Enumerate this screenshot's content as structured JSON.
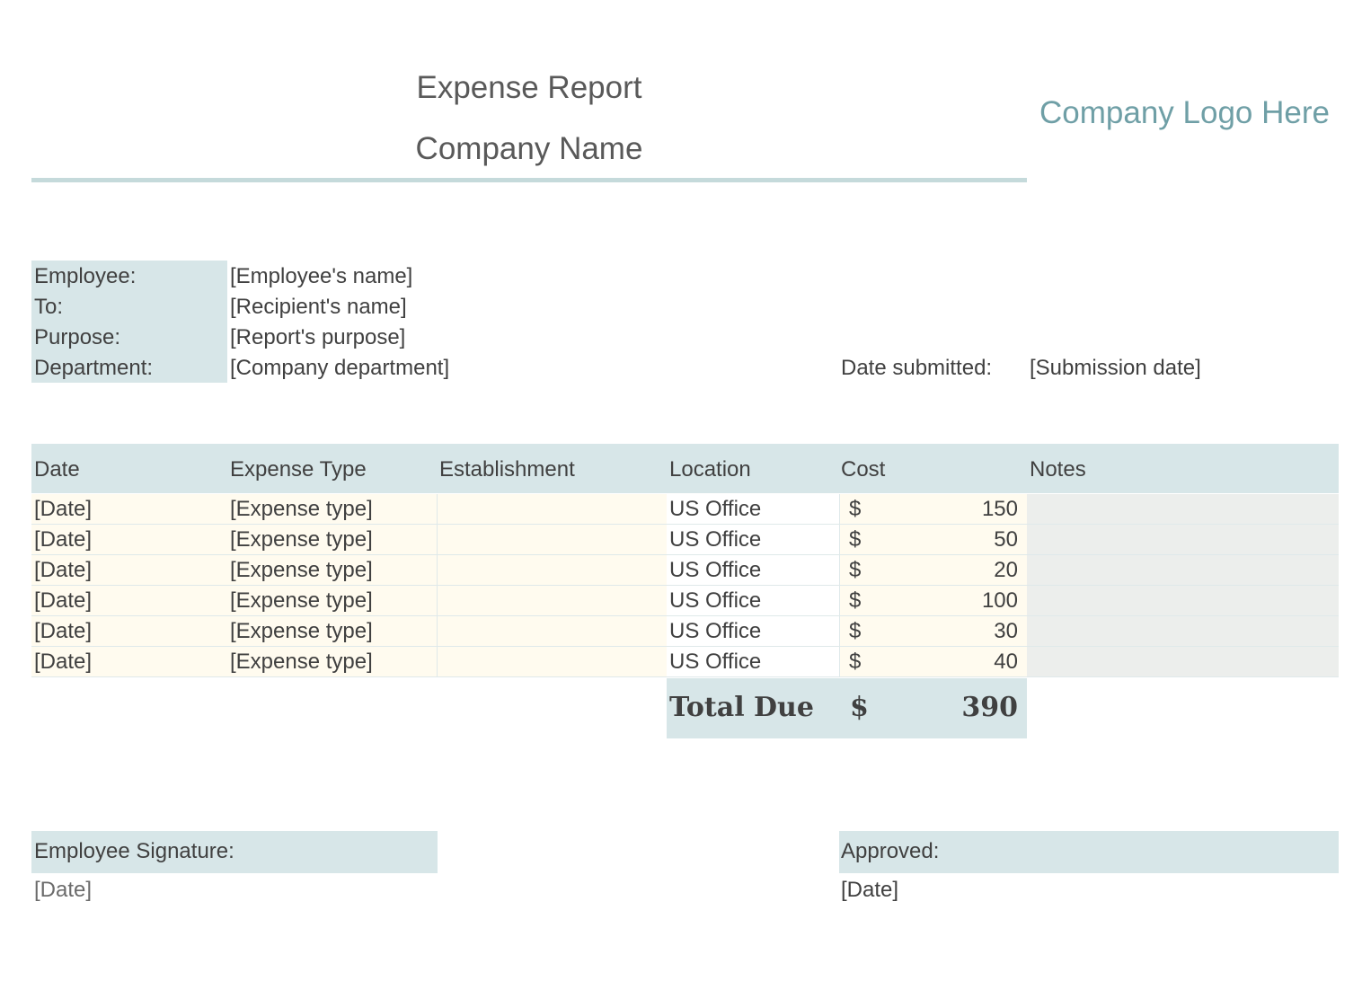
{
  "header": {
    "title": "Expense Report",
    "company_name": "Company Name",
    "logo_placeholder": "Company Logo Here"
  },
  "info": {
    "employee_label": "Employee:",
    "employee_value": "[Employee's name]",
    "to_label": "To:",
    "to_value": "[Recipient's name]",
    "purpose_label": "Purpose:",
    "purpose_value": "[Report's purpose]",
    "department_label": "Department:",
    "department_value": "[Company department]",
    "date_submitted_label": "Date submitted:",
    "date_submitted_value": "[Submission date]"
  },
  "table": {
    "columns": [
      "Date",
      "Expense Type",
      "Establishment",
      "Location",
      "Cost",
      "Notes"
    ],
    "rows": [
      {
        "date": "[Date]",
        "type": "[Expense type]",
        "establishment": "",
        "location": "US Office",
        "currency": "$",
        "cost": "150",
        "notes": ""
      },
      {
        "date": "[Date]",
        "type": "[Expense type]",
        "establishment": "",
        "location": "US Office",
        "currency": "$",
        "cost": "50",
        "notes": ""
      },
      {
        "date": "[Date]",
        "type": "[Expense type]",
        "establishment": "",
        "location": "US Office",
        "currency": "$",
        "cost": "20",
        "notes": ""
      },
      {
        "date": "[Date]",
        "type": "[Expense type]",
        "establishment": "",
        "location": "US Office",
        "currency": "$",
        "cost": "100",
        "notes": ""
      },
      {
        "date": "[Date]",
        "type": "[Expense type]",
        "establishment": "",
        "location": "US Office",
        "currency": "$",
        "cost": "30",
        "notes": ""
      },
      {
        "date": "[Date]",
        "type": "[Expense type]",
        "establishment": "",
        "location": "US Office",
        "currency": "$",
        "cost": "40",
        "notes": ""
      }
    ],
    "total_label": "Total Due",
    "total_currency": "$",
    "total_value": "390"
  },
  "signatures": {
    "employee_label": "Employee Signature:",
    "employee_date": "[Date]",
    "approved_label": "Approved:",
    "approved_date": "[Date]"
  },
  "colors": {
    "accent_fill": "#d7e6e8",
    "rule": "#c5dadb",
    "logo_text": "#6f9fa6",
    "row_fill": "#fffbef",
    "notes_fill": "#eceeec"
  }
}
